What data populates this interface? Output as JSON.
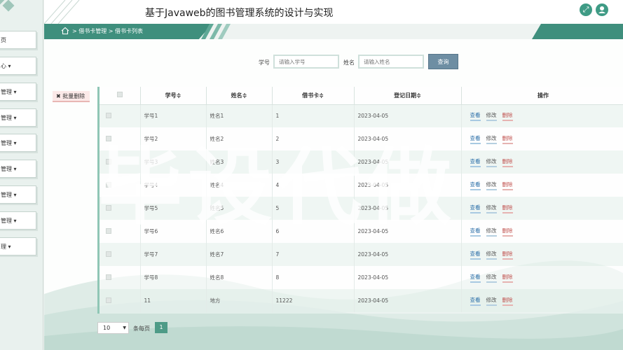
{
  "header": {
    "title": "基于Javaweb的图书管理系统的设计与实现",
    "fullscreen_icon": "expand-icon",
    "user_icon": "user-icon",
    "accent": "#3f9b85"
  },
  "breadcrumb": {
    "text": "> 借书卡管理 > 借书卡列表",
    "home_icon": "home-icon"
  },
  "sidebar": {
    "items": [
      {
        "label": "页"
      },
      {
        "label": "心 ▾"
      },
      {
        "label": "管理 ▾"
      },
      {
        "label": "管理 ▾"
      },
      {
        "label": "管理 ▾"
      },
      {
        "label": "管理 ▾"
      },
      {
        "label": "管理 ▾"
      },
      {
        "label": "管理 ▾"
      },
      {
        "label": "理 ▾"
      }
    ]
  },
  "search": {
    "student_id_label": "学号",
    "student_id_placeholder": "请输入学号",
    "name_label": "姓名",
    "name_placeholder": "请输入姓名",
    "button_label": "查询"
  },
  "bulk_delete_label": "✖ 批量删除",
  "table": {
    "columns": [
      "学号≑",
      "姓名≑",
      "借书卡≑",
      "登记日期≑",
      "操作"
    ],
    "actions": {
      "view": "查看",
      "edit": "修改",
      "delete": "删除"
    },
    "rows": [
      {
        "student_id": "学号1",
        "name": "姓名1",
        "card": "1",
        "date": "2023-04-05"
      },
      {
        "student_id": "学号2",
        "name": "姓名2",
        "card": "2",
        "date": "2023-04-05"
      },
      {
        "student_id": "学号3",
        "name": "姓名3",
        "card": "3",
        "date": "2023-04-05"
      },
      {
        "student_id": "学号4",
        "name": "姓名4",
        "card": "4",
        "date": "2023-04-05"
      },
      {
        "student_id": "学号5",
        "name": "姓名5",
        "card": "5",
        "date": "2023-04-05"
      },
      {
        "student_id": "学号6",
        "name": "姓名6",
        "card": "6",
        "date": "2023-04-05"
      },
      {
        "student_id": "学号7",
        "name": "姓名7",
        "card": "7",
        "date": "2023-04-05"
      },
      {
        "student_id": "学号8",
        "name": "姓名8",
        "card": "8",
        "date": "2023-04-05"
      },
      {
        "student_id": "11",
        "name": "地方",
        "card": "11222",
        "date": "2023-04-05"
      }
    ]
  },
  "pager": {
    "page_size": "10",
    "per_page_label": "条每页",
    "current_page": "1"
  },
  "watermark": "毕设代做"
}
